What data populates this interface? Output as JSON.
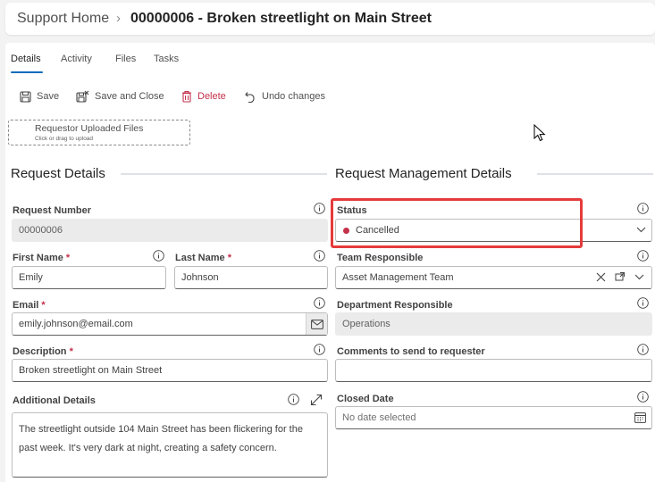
{
  "breadcrumb": {
    "home": "Support Home",
    "separator": "›",
    "title": "00000006 - Broken streetlight on Main Street"
  },
  "tabs": [
    {
      "label": "Details",
      "active": true
    },
    {
      "label": "Activity",
      "active": false
    },
    {
      "label": "Files",
      "active": false
    },
    {
      "label": "Tasks",
      "active": false
    }
  ],
  "toolbar": {
    "save": "Save",
    "save_close": "Save and Close",
    "delete": "Delete",
    "undo": "Undo changes"
  },
  "upload": {
    "label": "Requestor Uploaded Files",
    "hint": "Click or drag to upload"
  },
  "sections": {
    "left": "Request Details",
    "right": "Request Management Details"
  },
  "form": {
    "request_number": {
      "label": "Request Number",
      "value": "00000006"
    },
    "first_name": {
      "label": "First Name",
      "required": "*",
      "value": "Emily"
    },
    "last_name": {
      "label": "Last Name",
      "required": "*",
      "value": "Johnson"
    },
    "email": {
      "label": "Email",
      "required": "*",
      "value": "emily.johnson@email.com"
    },
    "description": {
      "label": "Description",
      "required": "*",
      "value": "Broken streetlight on Main Street"
    },
    "additional_details": {
      "label": "Additional Details",
      "line1": "The streetlight outside 104 Main Street has been flickering for the",
      "line2": "past week. It's very dark at night, creating a safety concern."
    },
    "status": {
      "label": "Status",
      "value": "Cancelled",
      "dot_color": "#c4314b"
    },
    "team_responsible": {
      "label": "Team Responsible",
      "value": "Asset Management Team"
    },
    "department_responsible": {
      "label": "Department Responsible",
      "value": "Operations"
    },
    "comments": {
      "label": "Comments to send to requester",
      "value": ""
    },
    "closed_date": {
      "label": "Closed Date",
      "placeholder": "No date selected"
    }
  },
  "colors": {
    "accent": "#0f6cbd",
    "required": "#c4314b",
    "highlight": "#e53b3b"
  },
  "icons": [
    "save-icon",
    "save-close-icon",
    "delete-icon",
    "undo-icon",
    "info-icon",
    "expand-icon",
    "mail-icon",
    "chevron-down-icon",
    "clear-icon",
    "open-record-icon",
    "calendar-icon",
    "mouse-cursor-icon"
  ]
}
